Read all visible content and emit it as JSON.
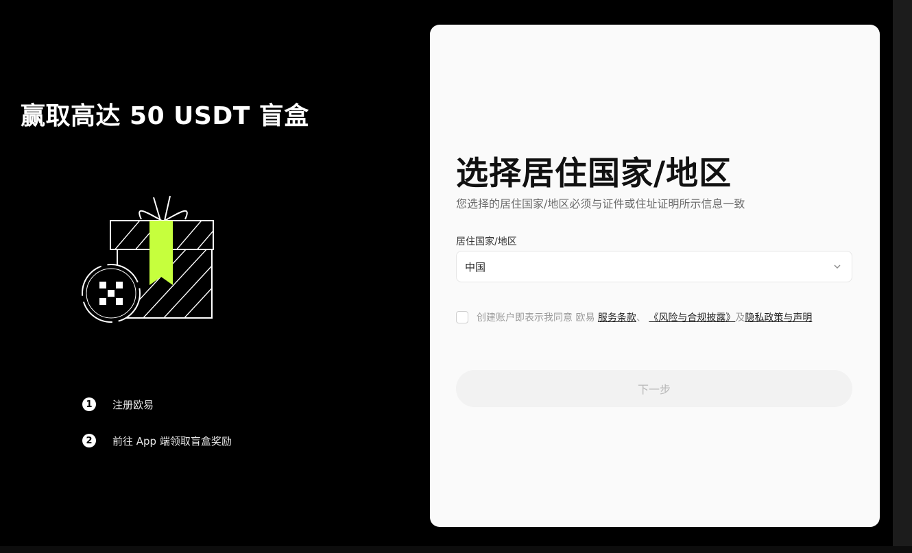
{
  "promo": {
    "title": "赢取高达 50 USDT 盲盒",
    "steps": [
      {
        "num": "1",
        "text": "注册欧易"
      },
      {
        "num": "2",
        "text": "前往 App 端领取盲盒奖励"
      }
    ]
  },
  "icons": {
    "gift": "gift-box-icon",
    "logo": "okx-logo-icon",
    "dropdown": "chevron-down-icon"
  },
  "colors": {
    "background": "#000000",
    "card": "#fafafa",
    "accent_ribbon": "#c6ff3d",
    "button_disabled_bg": "#f2f2f2",
    "button_disabled_text": "#b8b8b8"
  },
  "form": {
    "title": "选择居住国家/地区",
    "subtitle": "您选择的居住国家/地区必须与证件或住址证明所示信息一致",
    "field_label": "居住国家/地区",
    "selected_country": "中国",
    "agree_prefix": "创建账户即表示我同意 欧易",
    "terms_link": "服务条款",
    "sep": "、",
    "risk_link": "《风险与合规披露》",
    "and": "及",
    "privacy_link": "隐私政策与声明",
    "checkbox_checked": false,
    "next_label": "下一步"
  }
}
